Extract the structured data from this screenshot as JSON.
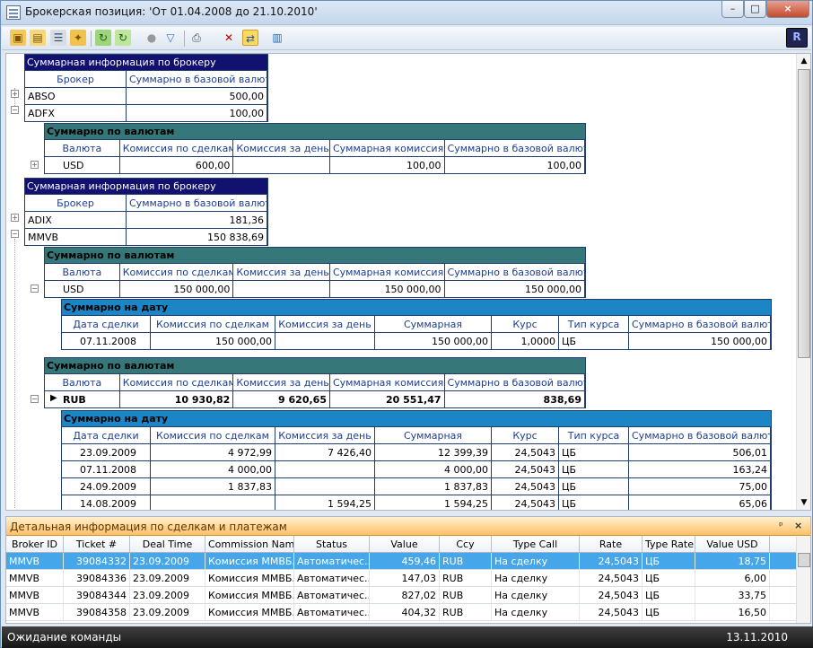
{
  "window": {
    "title": "Брокерская позиция: 'От 01.04.2008 до 21.10.2010'",
    "min": "–",
    "max": "□",
    "close": "×"
  },
  "toolbar": {
    "icons": [
      "folder-open-icon",
      "folder-icon",
      "print-preview-icon",
      "folder-star-icon",
      "refresh-icon",
      "refresh-dropdown-icon",
      "stop-icon",
      "filter-icon",
      "printer-icon",
      "clear-filter-icon",
      "group-icon",
      "export-icon",
      "R-icon"
    ],
    "r": "R"
  },
  "broker_band": {
    "title": "Суммарная информация по брокеру",
    "col_broker": "Брокер",
    "col_sum": "Суммарно в базовой валюте"
  },
  "brokers1": [
    {
      "name": "ABSO",
      "sum": "500,00"
    },
    {
      "name": "ADFX",
      "sum": "100,00"
    }
  ],
  "brokers2": [
    {
      "name": "ADIX",
      "sum": "181,36"
    },
    {
      "name": "MMVB",
      "sum": "150 838,69"
    }
  ],
  "currency_band": {
    "title": "Суммарно по валютам",
    "cols": [
      "Валюта",
      "Комиссия по сделкам",
      "Комиссия за день",
      "Суммарная комиссия",
      "Суммарно в базовой валюте"
    ]
  },
  "currency_usd1": {
    "ccy": "USD",
    "comm": "600,00",
    "day": "",
    "total": "100,00",
    "base": "100,00"
  },
  "currency_usd2": {
    "ccy": "USD",
    "comm": "150 000,00",
    "day": "",
    "total": "150 000,00",
    "base": "150 000,00"
  },
  "date_band": {
    "title": "Суммарно на дату",
    "cols": [
      "Дата сделки",
      "Комиссия по сделкам",
      "Комиссия за день",
      "Суммарная",
      "Курс",
      "Тип курса",
      "Суммарно в базовой валюте"
    ]
  },
  "date_row_usd": {
    "date": "07.11.2008",
    "comm": "150 000,00",
    "day": "",
    "sum": "150 000,00",
    "rate": "1,0000",
    "type": "ЦБ",
    "base": "150 000,00"
  },
  "currency_rub": {
    "ccy": "RUB",
    "comm": "10 930,82",
    "day": "9 620,65",
    "total": "20 551,47",
    "base": "838,69"
  },
  "date_rows_rub": [
    {
      "date": "23.09.2009",
      "comm": "4 972,99",
      "day": "7 426,40",
      "sum": "12 399,39",
      "rate": "24,5043",
      "type": "ЦБ",
      "base": "506,01"
    },
    {
      "date": "07.11.2008",
      "comm": "4 000,00",
      "day": "",
      "sum": "4 000,00",
      "rate": "24,5043",
      "type": "ЦБ",
      "base": "163,24"
    },
    {
      "date": "24.09.2009",
      "comm": "1 837,83",
      "day": "",
      "sum": "1 837,83",
      "rate": "24,5043",
      "type": "ЦБ",
      "base": "75,00"
    },
    {
      "date": "14.08.2009",
      "comm": "",
      "day": "1 594,25",
      "sum": "1 594,25",
      "rate": "24,5043",
      "type": "ЦБ",
      "base": "65,06"
    }
  ],
  "detail": {
    "title": "Детальная информация по сделкам и платежам",
    "pin": "ᵖ",
    "close": "×",
    "cols": [
      "Broker ID",
      "Ticket #",
      "Deal Time",
      "Commission Name",
      "Status",
      "Value",
      "Ccy",
      "Type Call",
      "Rate",
      "Type Rate",
      "Value USD"
    ],
    "rows": [
      {
        "broker": "MMVB",
        "ticket": "39084332",
        "time": "23.09.2009",
        "name": "Комиссия ММВБ...",
        "status": "Автоматичес...",
        "value": "459,46",
        "ccy": "RUB",
        "call": "На сделку",
        "rate": "24,5043",
        "rtype": "ЦБ",
        "usd": "18,75"
      },
      {
        "broker": "MMVB",
        "ticket": "39084336",
        "time": "23.09.2009",
        "name": "Комиссия ММВБ...",
        "status": "Автоматичес...",
        "value": "147,03",
        "ccy": "RUB",
        "call": "На сделку",
        "rate": "24,5043",
        "rtype": "ЦБ",
        "usd": "6,00"
      },
      {
        "broker": "MMVB",
        "ticket": "39084344",
        "time": "23.09.2009",
        "name": "Комиссия ММВБ...",
        "status": "Автоматичес...",
        "value": "827,02",
        "ccy": "RUB",
        "call": "На сделку",
        "rate": "24,5043",
        "rtype": "ЦБ",
        "usd": "33,75"
      },
      {
        "broker": "MMVB",
        "ticket": "39084358",
        "time": "23.09.2009",
        "name": "Комиссия ММВБ...",
        "status": "Автоматичес...",
        "value": "404,32",
        "ccy": "RUB",
        "call": "На сделку",
        "rate": "24,5043",
        "rtype": "ЦБ",
        "usd": "16,50"
      }
    ]
  },
  "status": {
    "text": "Ожидание команды",
    "date": "13.11.2010"
  }
}
